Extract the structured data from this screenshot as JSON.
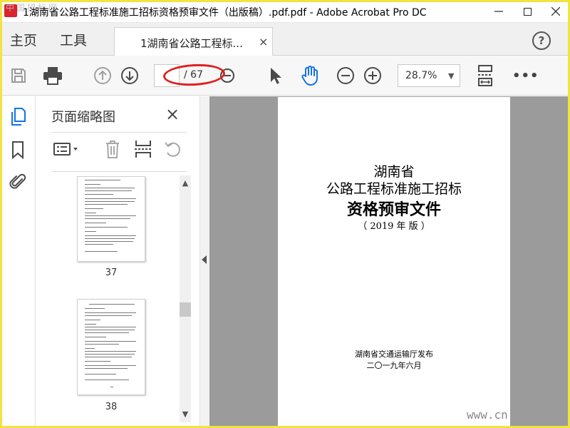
{
  "window": {
    "title": "1湖南省公路工程标准施工招标资格预审文件（出版稿）.pdf.pdf - Adobe Acrobat Pro DC",
    "watermark": "中国招标网"
  },
  "tabs": {
    "home": "主页",
    "tools": "工具",
    "document": "1湖南省公路工程标...",
    "document_close": "×"
  },
  "toolbar": {
    "page_current": "",
    "page_total": "/ 67",
    "zoom": "28.7%",
    "more": "•••"
  },
  "panel": {
    "title": "页面缩略图",
    "close": "×"
  },
  "thumbnails": [
    {
      "page": "37"
    },
    {
      "page": "38"
    }
  ],
  "document": {
    "line1": "湖南省",
    "line2": "公路工程标准施工招标",
    "line3": "资格预审文件",
    "line4": "（ 2019 年 版 ）",
    "publisher": "湖南省交通运输厅发布",
    "date": "二〇一九年六月"
  },
  "corner_watermark": "www.cn",
  "colors": {
    "accent_blue": "#1473e6",
    "annotation_red": "#e02020",
    "frame_yellow": "#f2e341",
    "canvas_gray": "#9b9b9b"
  }
}
